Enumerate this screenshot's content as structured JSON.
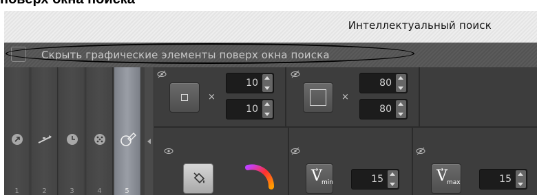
{
  "document": {
    "heading": "поверх окна поиска"
  },
  "window": {
    "title": "Интеллектуальный поиск"
  },
  "hide_overlay": {
    "label": "Скрыть графические элементы поверх окна поиска",
    "checked": false
  },
  "toolbar": {
    "tools": [
      {
        "num": "1",
        "icon": "move-arrow-icon"
      },
      {
        "num": "2",
        "icon": "line-arrow-icon"
      },
      {
        "num": "3",
        "icon": "clock-icon"
      },
      {
        "num": "4",
        "icon": "dots-icon"
      },
      {
        "num": "5",
        "icon": "pencil-tool-icon",
        "active": true
      }
    ]
  },
  "size_panel": {
    "min_width": "10",
    "min_height": "10",
    "max_width": "80",
    "max_height": "80",
    "multiply_sign": "×"
  },
  "speed_panel": {
    "v_min_label": "V",
    "v_min_sub": "min",
    "v_min_value": "15",
    "v_max_label": "V",
    "v_max_sub": "max",
    "v_max_value": "15"
  },
  "colors": {
    "accent_gradient": [
      "#c040ff",
      "#ff3030",
      "#ff9a00"
    ]
  }
}
